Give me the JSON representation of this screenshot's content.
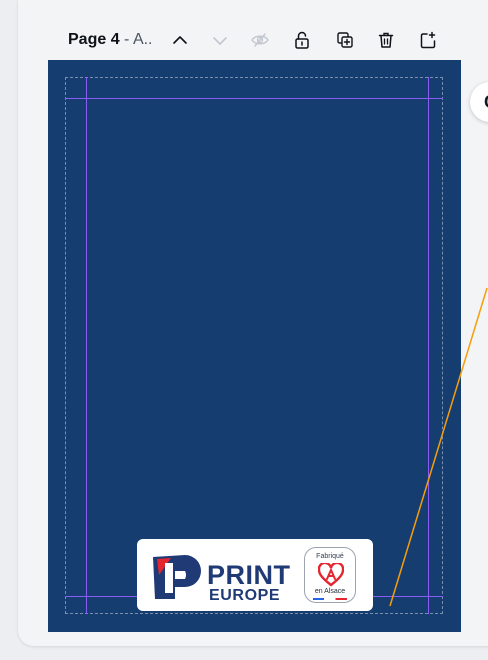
{
  "header": {
    "page_label": "Page 4",
    "separator": " - ",
    "page_name_truncated": "A.."
  },
  "toolbar": {
    "icons": [
      "chevron-up-icon",
      "chevron-down-icon",
      "hide-eye-icon",
      "unlock-icon",
      "duplicate-page-icon",
      "trash-icon",
      "add-page-icon"
    ]
  },
  "canvas": {
    "background_color": "#163d6f",
    "guide_color": "#8a5cf6",
    "bleed_line_color": "#c8d2e1"
  },
  "logo": {
    "word1": "PRINT",
    "word2": "EUROPE",
    "brand_color": "#1f3a75",
    "accent_color": "#e3262f",
    "badge_top": "Fabriqué",
    "badge_bottom": "en Alsace"
  },
  "side_button": {
    "label": "C"
  },
  "annotation_line_color": "#f59e0b"
}
